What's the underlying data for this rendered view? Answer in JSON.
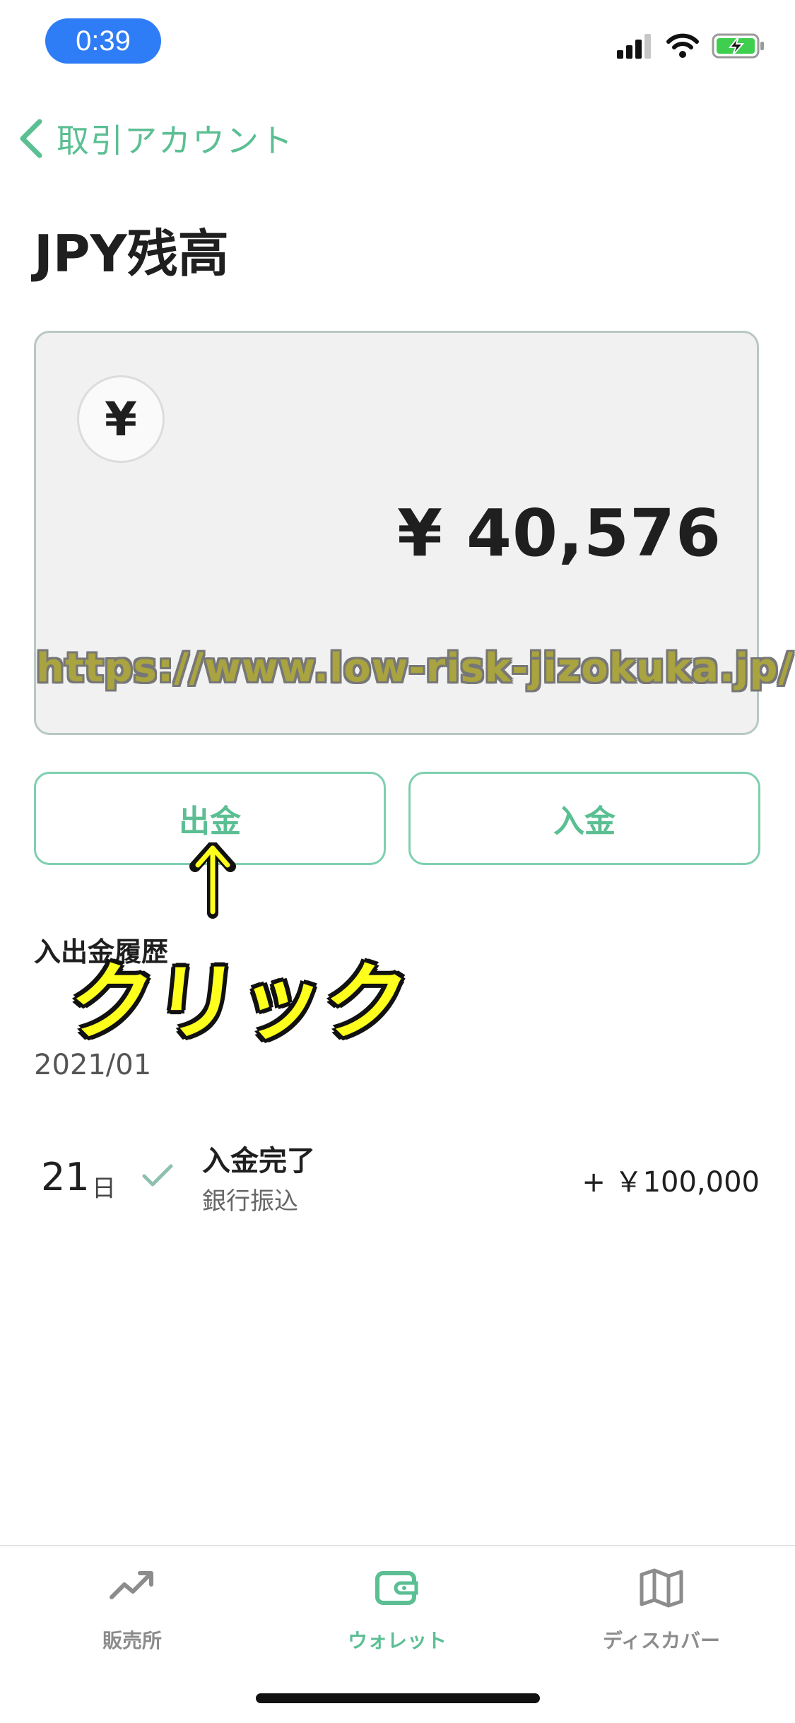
{
  "status_bar": {
    "time": "0:39"
  },
  "nav": {
    "back_label": "取引アカウント"
  },
  "page": {
    "title": "JPY残高"
  },
  "balance": {
    "currency_symbol": "¥",
    "amount": "¥ 40,576"
  },
  "watermark": "https://www.low-risk-jizokuka.jp/",
  "actions": {
    "withdraw": "出金",
    "deposit": "入金"
  },
  "annotation": {
    "click_label": "クリック"
  },
  "history": {
    "heading": "入出金履歴",
    "month": "2021/01",
    "transactions": [
      {
        "day": "21",
        "day_unit": "日",
        "title": "入金完了",
        "method": "銀行振込",
        "amount": "+ ￥100,000"
      }
    ]
  },
  "tab_bar": {
    "items": [
      {
        "label": "販売所",
        "icon": "trend-chart-icon",
        "active": false
      },
      {
        "label": "ウォレット",
        "icon": "wallet-icon",
        "active": true
      },
      {
        "label": "ディスカバー",
        "icon": "map-icon",
        "active": false
      }
    ]
  },
  "colors": {
    "accent": "#5bbf93",
    "time_pill": "#2f7df6",
    "card_bg": "#f1f1f1",
    "annotation_yellow": "#ffff1e",
    "battery_green": "#3fcf4f"
  }
}
